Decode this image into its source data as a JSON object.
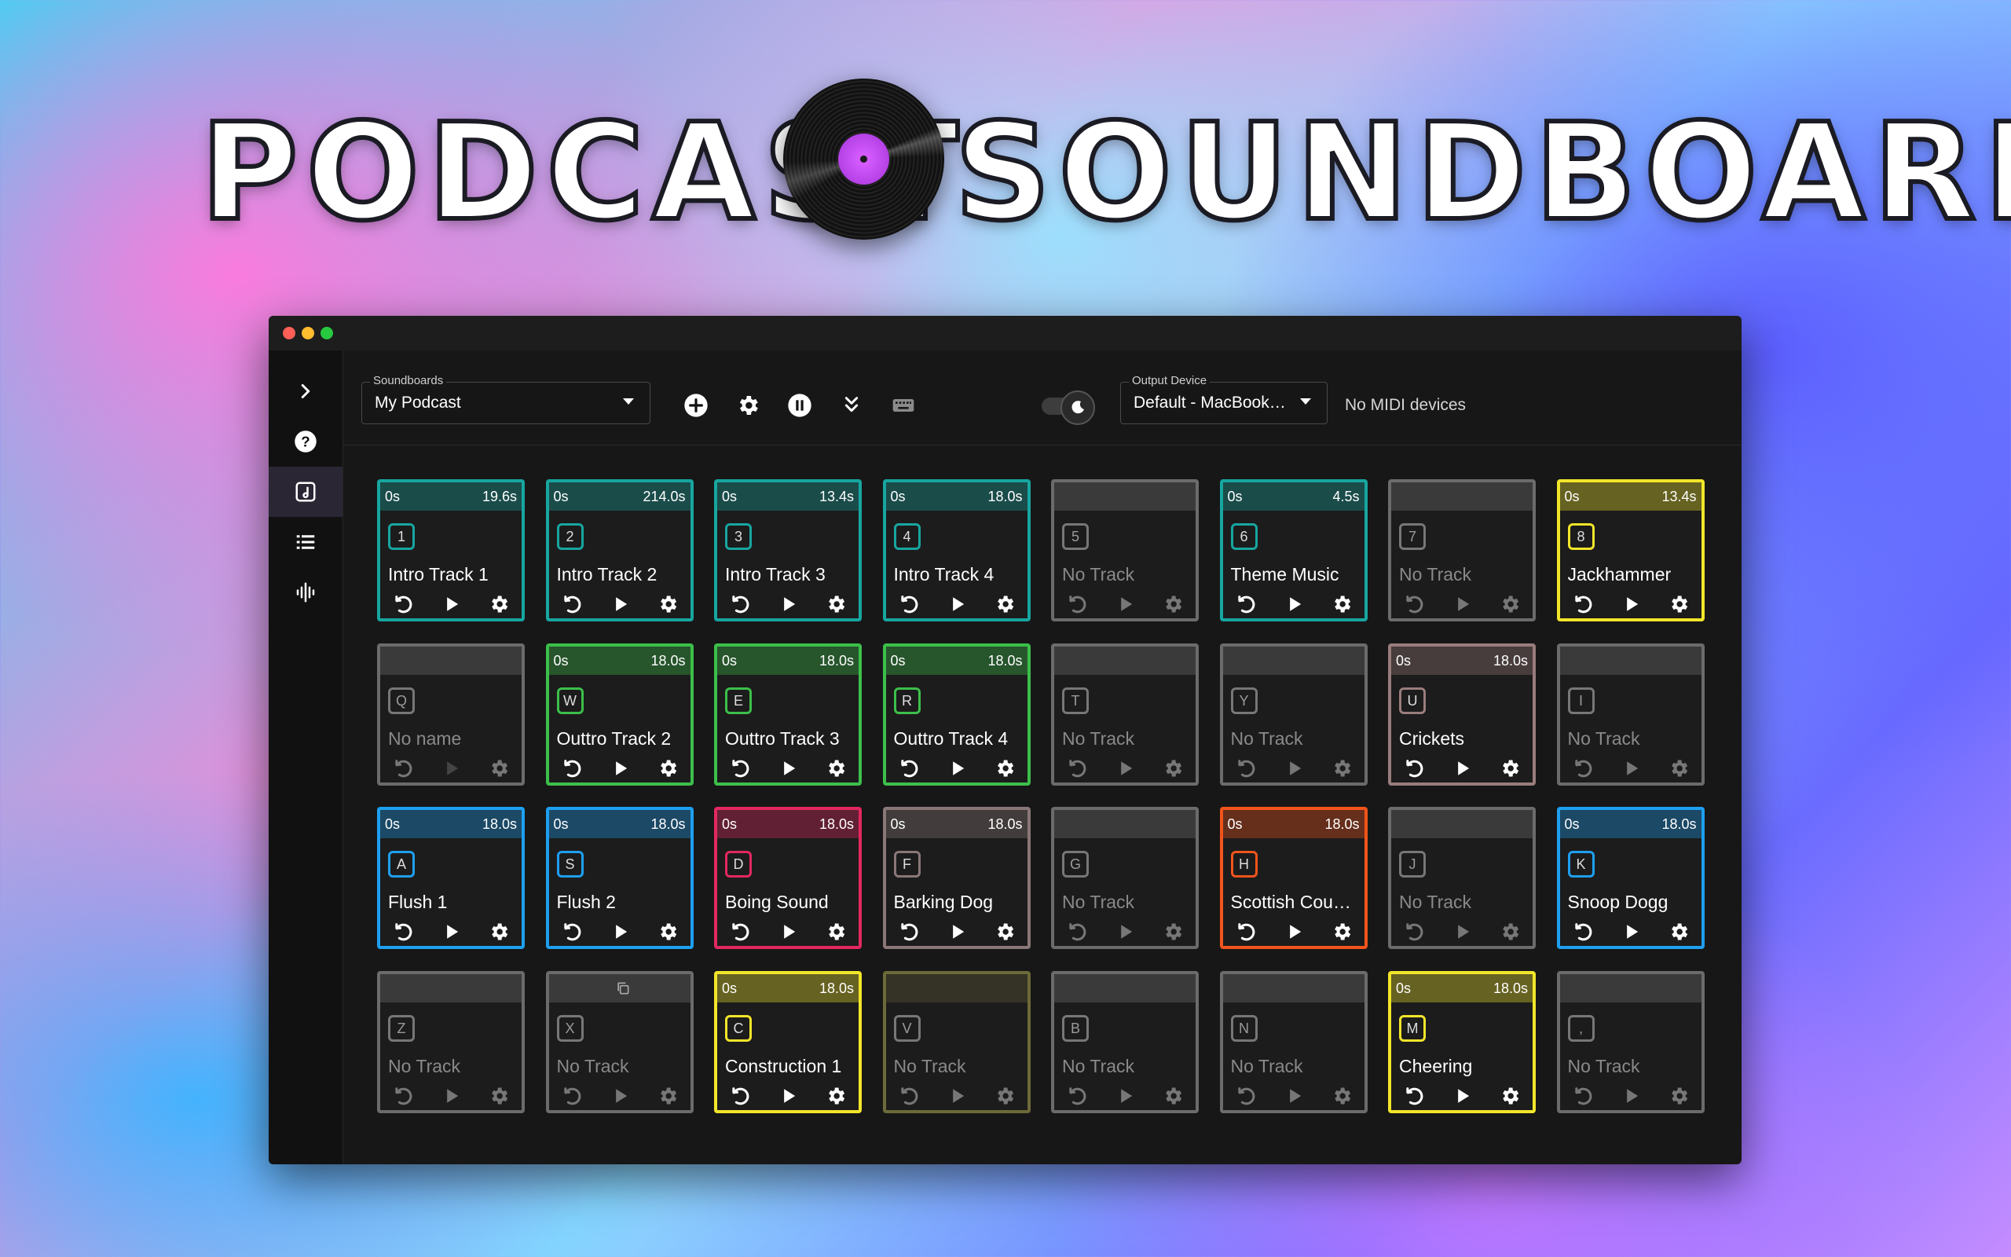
{
  "hero": {
    "left_word": "PODCAST",
    "right_word": "SOUNDBOARD"
  },
  "icons": {
    "sidebar": [
      "chevron-right-icon",
      "help-icon",
      "music-note-icon",
      "list-icon",
      "waveform-icon"
    ],
    "toolbar": [
      "add-icon",
      "gear-icon",
      "pause-icon",
      "chevrons-down-icon",
      "keyboard-icon",
      "moon-icon"
    ]
  },
  "toolbar": {
    "soundboards_label": "Soundboards",
    "soundboards_value": "My Podcast",
    "output_label": "Output Device",
    "output_value": "Default - MacBook…",
    "midi_text": "No MIDI devices"
  },
  "pads": [
    {
      "key": "1",
      "name": "Intro Track 1",
      "start": "0s",
      "duration": "19.6s",
      "color": "#17a6a0",
      "empty": false
    },
    {
      "key": "2",
      "name": "Intro Track 2",
      "start": "0s",
      "duration": "214.0s",
      "color": "#17a6a0",
      "empty": false
    },
    {
      "key": "3",
      "name": "Intro Track 3",
      "start": "0s",
      "duration": "13.4s",
      "color": "#17a6a0",
      "empty": false
    },
    {
      "key": "4",
      "name": "Intro Track 4",
      "start": "0s",
      "duration": "18.0s",
      "color": "#17a6a0",
      "empty": false
    },
    {
      "key": "5",
      "name": "No Track",
      "start": "",
      "duration": "",
      "color": "#6b6b6b",
      "empty": true
    },
    {
      "key": "6",
      "name": "Theme Music",
      "start": "0s",
      "duration": "4.5s",
      "color": "#17a6a0",
      "empty": false
    },
    {
      "key": "7",
      "name": "No Track",
      "start": "",
      "duration": "",
      "color": "#6b6b6b",
      "empty": true
    },
    {
      "key": "8",
      "name": "Jackhammer",
      "start": "0s",
      "duration": "13.4s",
      "color": "#f2e52a",
      "empty": false
    },
    {
      "key": "Q",
      "name": "No name",
      "start": "",
      "duration": "",
      "color": "#6b6b6b",
      "empty": true
    },
    {
      "key": "W",
      "name": "Outtro Track 2",
      "start": "0s",
      "duration": "18.0s",
      "color": "#3cbf4a",
      "empty": false
    },
    {
      "key": "E",
      "name": "Outtro Track 3",
      "start": "0s",
      "duration": "18.0s",
      "color": "#3cbf4a",
      "empty": false
    },
    {
      "key": "R",
      "name": "Outtro Track 4",
      "start": "0s",
      "duration": "18.0s",
      "color": "#3cbf4a",
      "empty": false
    },
    {
      "key": "T",
      "name": "No Track",
      "start": "",
      "duration": "",
      "color": "#6b6b6b",
      "empty": true
    },
    {
      "key": "Y",
      "name": "No Track",
      "start": "",
      "duration": "",
      "color": "#6b6b6b",
      "empty": true
    },
    {
      "key": "U",
      "name": "Crickets",
      "start": "0s",
      "duration": "18.0s",
      "color": "#9a7c7c",
      "empty": false
    },
    {
      "key": "I",
      "name": "No Track",
      "start": "",
      "duration": "",
      "color": "#6b6b6b",
      "empty": true
    },
    {
      "key": "A",
      "name": "Flush 1",
      "start": "0s",
      "duration": "18.0s",
      "color": "#1e9ff0",
      "empty": false
    },
    {
      "key": "S",
      "name": "Flush 2",
      "start": "0s",
      "duration": "18.0s",
      "color": "#1e9ff0",
      "empty": false
    },
    {
      "key": "D",
      "name": "Boing Sound",
      "start": "0s",
      "duration": "18.0s",
      "color": "#e2285f",
      "empty": false
    },
    {
      "key": "F",
      "name": "Barking Dog",
      "start": "0s",
      "duration": "18.0s",
      "color": "#8a7777",
      "empty": false
    },
    {
      "key": "G",
      "name": "No Track",
      "start": "",
      "duration": "",
      "color": "#6b6b6b",
      "empty": true
    },
    {
      "key": "H",
      "name": "Scottish Cou…",
      "start": "0s",
      "duration": "18.0s",
      "color": "#f2541b",
      "empty": false
    },
    {
      "key": "J",
      "name": "No Track",
      "start": "",
      "duration": "",
      "color": "#6b6b6b",
      "empty": true
    },
    {
      "key": "K",
      "name": "Snoop Dogg",
      "start": "0s",
      "duration": "18.0s",
      "color": "#1e9ff0",
      "empty": false
    },
    {
      "key": "Z",
      "name": "No Track",
      "start": "",
      "duration": "",
      "color": "#6b6b6b",
      "empty": true
    },
    {
      "key": "X",
      "name": "No Track",
      "start": "",
      "duration": "",
      "color": "#6b6b6b",
      "empty": true,
      "copy": true
    },
    {
      "key": "C",
      "name": "Construction 1",
      "start": "0s",
      "duration": "18.0s",
      "color": "#f2e52a",
      "empty": false
    },
    {
      "key": "V",
      "name": "No Track",
      "start": "",
      "duration": "",
      "color": "#6d6a3a",
      "empty": true
    },
    {
      "key": "B",
      "name": "No Track",
      "start": "",
      "duration": "",
      "color": "#6b6b6b",
      "empty": true
    },
    {
      "key": "N",
      "name": "No Track",
      "start": "",
      "duration": "",
      "color": "#6b6b6b",
      "empty": true
    },
    {
      "key": "M",
      "name": "Cheering",
      "start": "0s",
      "duration": "18.0s",
      "color": "#f2e52a",
      "empty": false
    },
    {
      "key": ",",
      "name": "No Track",
      "start": "",
      "duration": "",
      "color": "#6b6b6b",
      "empty": true
    }
  ]
}
